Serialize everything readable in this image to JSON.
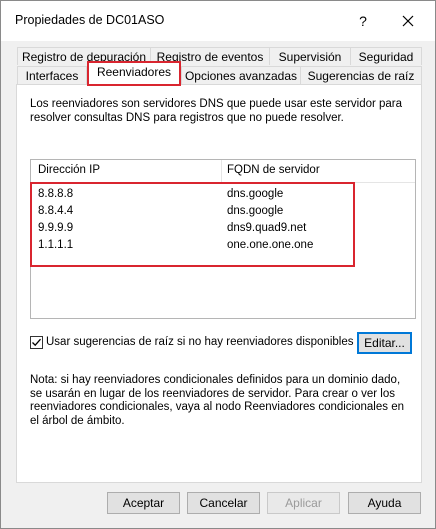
{
  "window": {
    "title": "Propiedades de DC01ASO",
    "help_glyph": "?",
    "close_label": "close"
  },
  "tabs": {
    "row1": [
      {
        "label": "Registro de depuración"
      },
      {
        "label": "Registro de eventos"
      },
      {
        "label": "Supervisión"
      },
      {
        "label": "Seguridad"
      }
    ],
    "row2": [
      {
        "label": "Interfaces"
      },
      {
        "label": "Reenviadores",
        "active": true
      },
      {
        "label": "Opciones avanzadas"
      },
      {
        "label": "Sugerencias de raíz"
      }
    ]
  },
  "panel": {
    "description": "Los reenviadores son servidores DNS que puede usar este servidor para resolver consultas DNS para registros que no puede resolver.",
    "columns": [
      "Dirección IP",
      "FQDN de servidor"
    ],
    "forwarders": [
      {
        "ip": "8.8.8.8",
        "fqdn": "dns.google"
      },
      {
        "ip": "8.8.4.4",
        "fqdn": "dns.google"
      },
      {
        "ip": "9.9.9.9",
        "fqdn": "dns9.quad9.net"
      },
      {
        "ip": "1.1.1.1",
        "fqdn": "one.one.one.one"
      }
    ],
    "use_root_hints_label": "Usar sugerencias de raíz si no hay reenviadores disponibles",
    "use_root_hints_checked": true,
    "edit_button": "Editar...",
    "note": "Nota: si hay reenviadores condicionales definidos para un dominio dado, se usarán en lugar de los reenviadores de servidor. Para crear o ver los reenviadores condicionales, vaya al nodo Reenviadores condicionales en el árbol de ámbito."
  },
  "footer": {
    "accept": "Aceptar",
    "cancel": "Cancelar",
    "apply": "Aplicar",
    "help": "Ayuda"
  },
  "colors": {
    "highlight_red": "#d9252f",
    "focus_blue": "#0078d7",
    "dialog_bg": "#f0f0f0"
  }
}
